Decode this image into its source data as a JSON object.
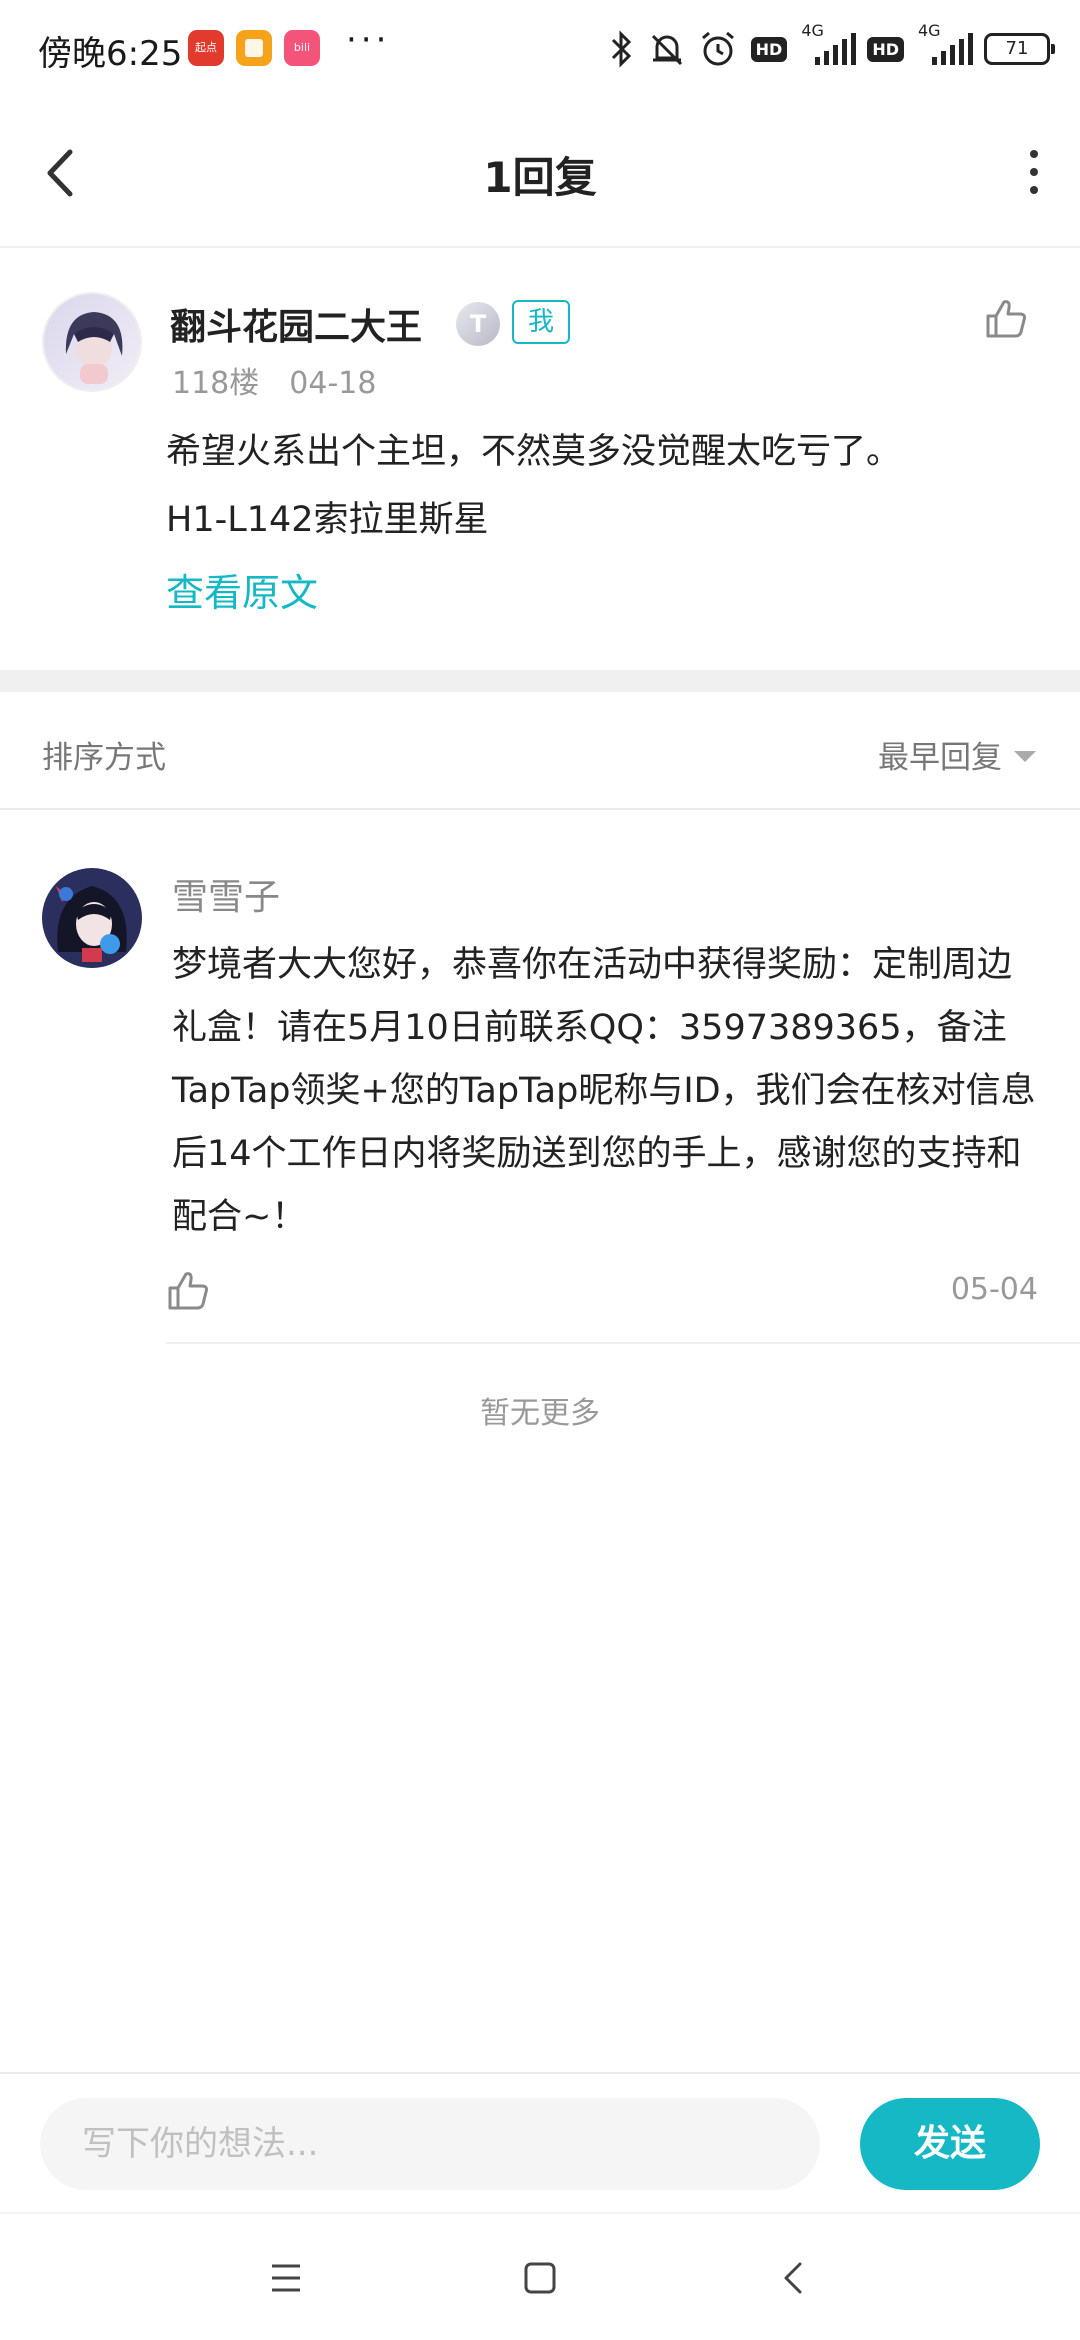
{
  "status_bar": {
    "time": "傍晚6:25",
    "more": "···",
    "network_1": "4G",
    "network_2": "4G",
    "hd": "HD",
    "battery": "71",
    "apps": [
      {
        "name": "qidian-app-icon",
        "label": "起点",
        "color": "#e23b2e"
      },
      {
        "name": "notes-app-icon",
        "label": "",
        "color": "#f7a21b"
      },
      {
        "name": "bilibili-app-icon",
        "label": "bili",
        "color": "#f5547a"
      }
    ]
  },
  "header": {
    "title": "1回复"
  },
  "post": {
    "author": "翻斗花园二大王",
    "badge_level": "T",
    "badge_me": "我",
    "floor": "118楼",
    "date": "04-18",
    "line1": "希望火系出个主坦，不然莫多没觉醒太吃亏了。",
    "line2": "H1-L142索拉里斯星",
    "view_original": "查看原文"
  },
  "sort": {
    "label": "排序方式",
    "selected": "最早回复"
  },
  "reply": {
    "author": "雪雪子",
    "text": "梦境者大大您好，恭喜你在活动中获得奖励：定制周边礼盒！请在5月10日前联系QQ：3597389365，备注TapTap领奖+您的TapTap昵称与ID，我们会在核对信息后14个工作日内将奖励送到您的手上，感谢您的支持和配合~！",
    "date": "05-04"
  },
  "no_more": "暂无更多",
  "composer": {
    "placeholder": "写下你的想法...",
    "send_label": "发送"
  },
  "colors": {
    "accent": "#15b8c4",
    "text": "#222222",
    "muted": "#999999"
  }
}
